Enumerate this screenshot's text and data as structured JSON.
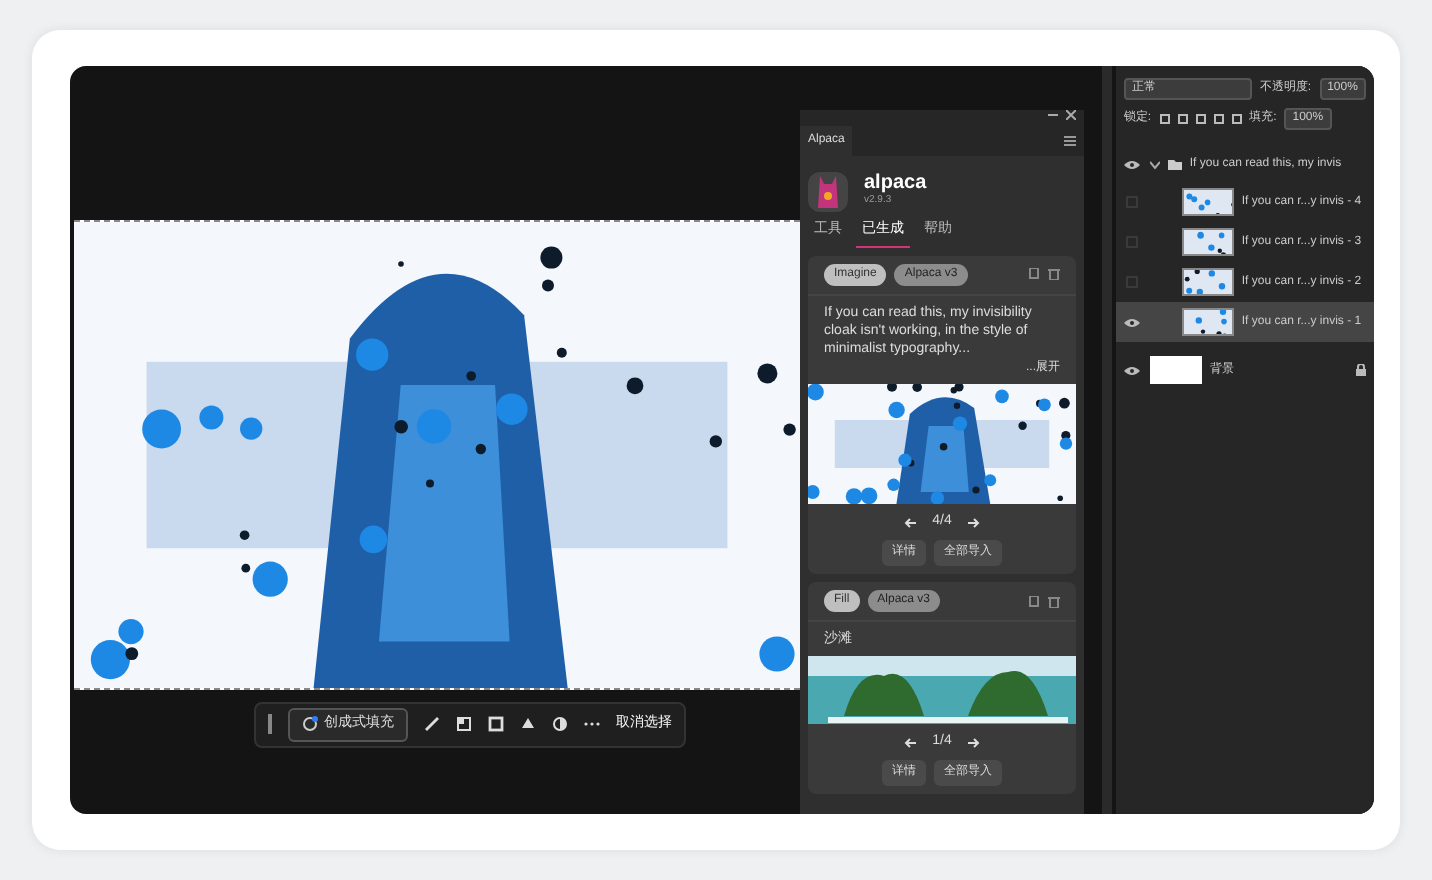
{
  "canvas": {
    "toolbar": {
      "generate_label": "创成式填充",
      "deselect_label": "取消选择"
    }
  },
  "alpaca_panel": {
    "tab": "Alpaca",
    "app_name": "alpaca",
    "version": "v2.9.3",
    "tabs": [
      {
        "label": "工具",
        "selected": false
      },
      {
        "label": "已生成",
        "selected": true
      },
      {
        "label": "帮助",
        "selected": false
      }
    ],
    "cards": [
      {
        "kind": "imagine",
        "tags": [
          "Imagine",
          "Alpaca v3"
        ],
        "prompt": "If you can read this, my invisibility cloak isn't working, in the style of minimalist typography...",
        "expand": "...展开",
        "pager": "4/4",
        "buttons": [
          "详情",
          "全部导入"
        ]
      },
      {
        "kind": "fill",
        "tags": [
          "Fill",
          "Alpaca v3"
        ],
        "prompt": "沙滩",
        "pager": "1/4",
        "buttons": [
          "详情",
          "全部导入"
        ]
      }
    ]
  },
  "layers_panel": {
    "blend_mode": "正常",
    "opacity_label": "不透明度:",
    "opacity": "100%",
    "lock_label": "锁定:",
    "fill_label": "填充:",
    "fill": "100%",
    "group": {
      "name": "If you can read this, my invis",
      "expanded": true,
      "visible": true,
      "children": [
        {
          "name": "If you can r...y invis - 4",
          "visible": false,
          "selected": false
        },
        {
          "name": "If you can r...y invis - 3",
          "visible": false,
          "selected": false
        },
        {
          "name": "If you can r...y invis - 2",
          "visible": false,
          "selected": false
        },
        {
          "name": "If you can r...y invis - 1",
          "visible": true,
          "selected": true
        }
      ]
    },
    "background": {
      "name": "背景",
      "visible": true,
      "locked": true
    }
  }
}
